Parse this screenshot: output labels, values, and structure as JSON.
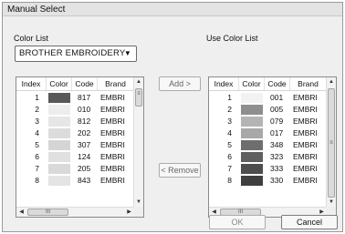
{
  "window": {
    "title": "Manual Select"
  },
  "color_list": {
    "label": "Color List",
    "dropdown_value": "BROTHER EMBROIDERY",
    "columns": [
      "Index",
      "Color",
      "Code",
      "Brand"
    ],
    "rows": [
      {
        "index": "1",
        "color": "#585858",
        "code": "817",
        "brand": "EMBRI"
      },
      {
        "index": "2",
        "color": "#ededed",
        "code": "010",
        "brand": "EMBRI"
      },
      {
        "index": "3",
        "color": "#e6e6e6",
        "code": "812",
        "brand": "EMBRI"
      },
      {
        "index": "4",
        "color": "#dcdcdc",
        "code": "202",
        "brand": "EMBRI"
      },
      {
        "index": "5",
        "color": "#d5d5d5",
        "code": "307",
        "brand": "EMBRI"
      },
      {
        "index": "6",
        "color": "#e0e0e0",
        "code": "124",
        "brand": "EMBRI"
      },
      {
        "index": "7",
        "color": "#d9d9d9",
        "code": "205",
        "brand": "EMBRI"
      },
      {
        "index": "8",
        "color": "#e4e4e4",
        "code": "843",
        "brand": "EMBRI"
      }
    ],
    "scroll_thumb_glyph": "≡",
    "hscroll_thumb_glyph": "III"
  },
  "use_color_list": {
    "label": "Use Color List",
    "columns": [
      "Index",
      "Color",
      "Code",
      "Brand"
    ],
    "rows": [
      {
        "index": "1",
        "color": "#f2f2f2",
        "code": "001",
        "brand": "EMBRI"
      },
      {
        "index": "2",
        "color": "#8e8e8e",
        "code": "005",
        "brand": "EMBRI"
      },
      {
        "index": "3",
        "color": "#b4b4b4",
        "code": "079",
        "brand": "EMBRI"
      },
      {
        "index": "4",
        "color": "#a8a8a8",
        "code": "017",
        "brand": "EMBRI"
      },
      {
        "index": "5",
        "color": "#6e6e6e",
        "code": "348",
        "brand": "EMBRI"
      },
      {
        "index": "6",
        "color": "#5f5f5f",
        "code": "323",
        "brand": "EMBRI"
      },
      {
        "index": "7",
        "color": "#4d4d4d",
        "code": "333",
        "brand": "EMBRI"
      },
      {
        "index": "8",
        "color": "#3f3f3f",
        "code": "330",
        "brand": "EMBRI"
      }
    ],
    "scroll_thumb_glyph": "≡",
    "hscroll_thumb_glyph": "III"
  },
  "buttons": {
    "add": "Add >",
    "remove": "< Remove",
    "ok": "OK",
    "cancel": "Cancel"
  },
  "icons": {
    "dropdown_arrow": "▼",
    "scroll_up": "▲",
    "scroll_down": "▼",
    "scroll_left": "◀",
    "scroll_right": "▶"
  }
}
